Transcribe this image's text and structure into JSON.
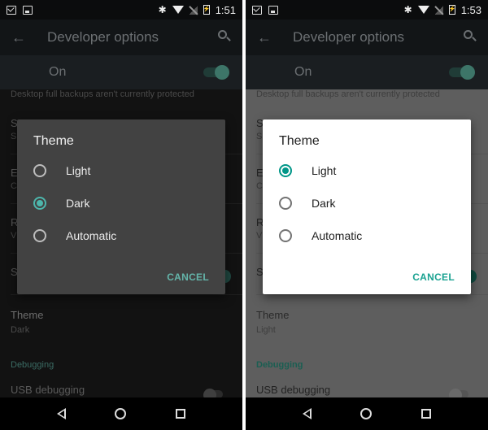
{
  "screens": [
    {
      "variant": "dark",
      "status_bar": {
        "time": "1:51",
        "notification_icons": [
          "mail-icon",
          "image-icon"
        ],
        "system_icons": [
          "bluetooth-icon",
          "wifi-icon",
          "no-signal-icon",
          "battery-charging-icon"
        ]
      },
      "toolbar": {
        "title": "Developer options",
        "back_icon": "arrow-back-icon",
        "search_icon": "search-icon"
      },
      "master_switch": {
        "label": "On",
        "state": "on"
      },
      "content": {
        "note": "Desktop full backups aren't currently protected",
        "partial_rows": [
          {
            "title_initial": "S",
            "subtitle_initial": "S"
          },
          {
            "title_initial": "E",
            "subtitle_initial": "C"
          },
          {
            "title_initial": "R",
            "subtitle_initial": "V"
          },
          {
            "title_initial": "S",
            "subtitle_initial": ""
          }
        ],
        "theme_pref": {
          "title": "Theme",
          "value": "Dark"
        },
        "category": "Debugging",
        "usb_debugging": {
          "label": "USB debugging",
          "state": "off"
        }
      },
      "dialog": {
        "title": "Theme",
        "options": [
          {
            "label": "Light",
            "checked": false
          },
          {
            "label": "Dark",
            "checked": true
          },
          {
            "label": "Automatic",
            "checked": false
          }
        ],
        "cancel_label": "CANCEL",
        "accent": "#4db6ac"
      }
    },
    {
      "variant": "light",
      "status_bar": {
        "time": "1:53",
        "notification_icons": [
          "mail-icon",
          "image-icon"
        ],
        "system_icons": [
          "bluetooth-icon",
          "wifi-icon",
          "no-signal-icon",
          "battery-charging-icon"
        ]
      },
      "toolbar": {
        "title": "Developer options",
        "back_icon": "arrow-back-icon",
        "search_icon": "search-icon"
      },
      "master_switch": {
        "label": "On",
        "state": "on"
      },
      "content": {
        "note": "Desktop full backups aren't currently protected",
        "partial_rows": [
          {
            "title_initial": "S",
            "subtitle_initial": "S"
          },
          {
            "title_initial": "E",
            "subtitle_initial": "C"
          },
          {
            "title_initial": "R",
            "subtitle_initial": "V"
          },
          {
            "title_initial": "S",
            "subtitle_initial": ""
          }
        ],
        "theme_pref": {
          "title": "Theme",
          "value": "Light"
        },
        "category": "Debugging",
        "usb_debugging": {
          "label": "USB debugging",
          "state": "off"
        }
      },
      "dialog": {
        "title": "Theme",
        "options": [
          {
            "label": "Light",
            "checked": true
          },
          {
            "label": "Dark",
            "checked": false
          },
          {
            "label": "Automatic",
            "checked": false
          }
        ],
        "cancel_label": "CANCEL",
        "accent": "#009688"
      }
    }
  ],
  "nav_bar": {
    "buttons": [
      "back-icon",
      "home-icon",
      "recents-icon"
    ]
  }
}
